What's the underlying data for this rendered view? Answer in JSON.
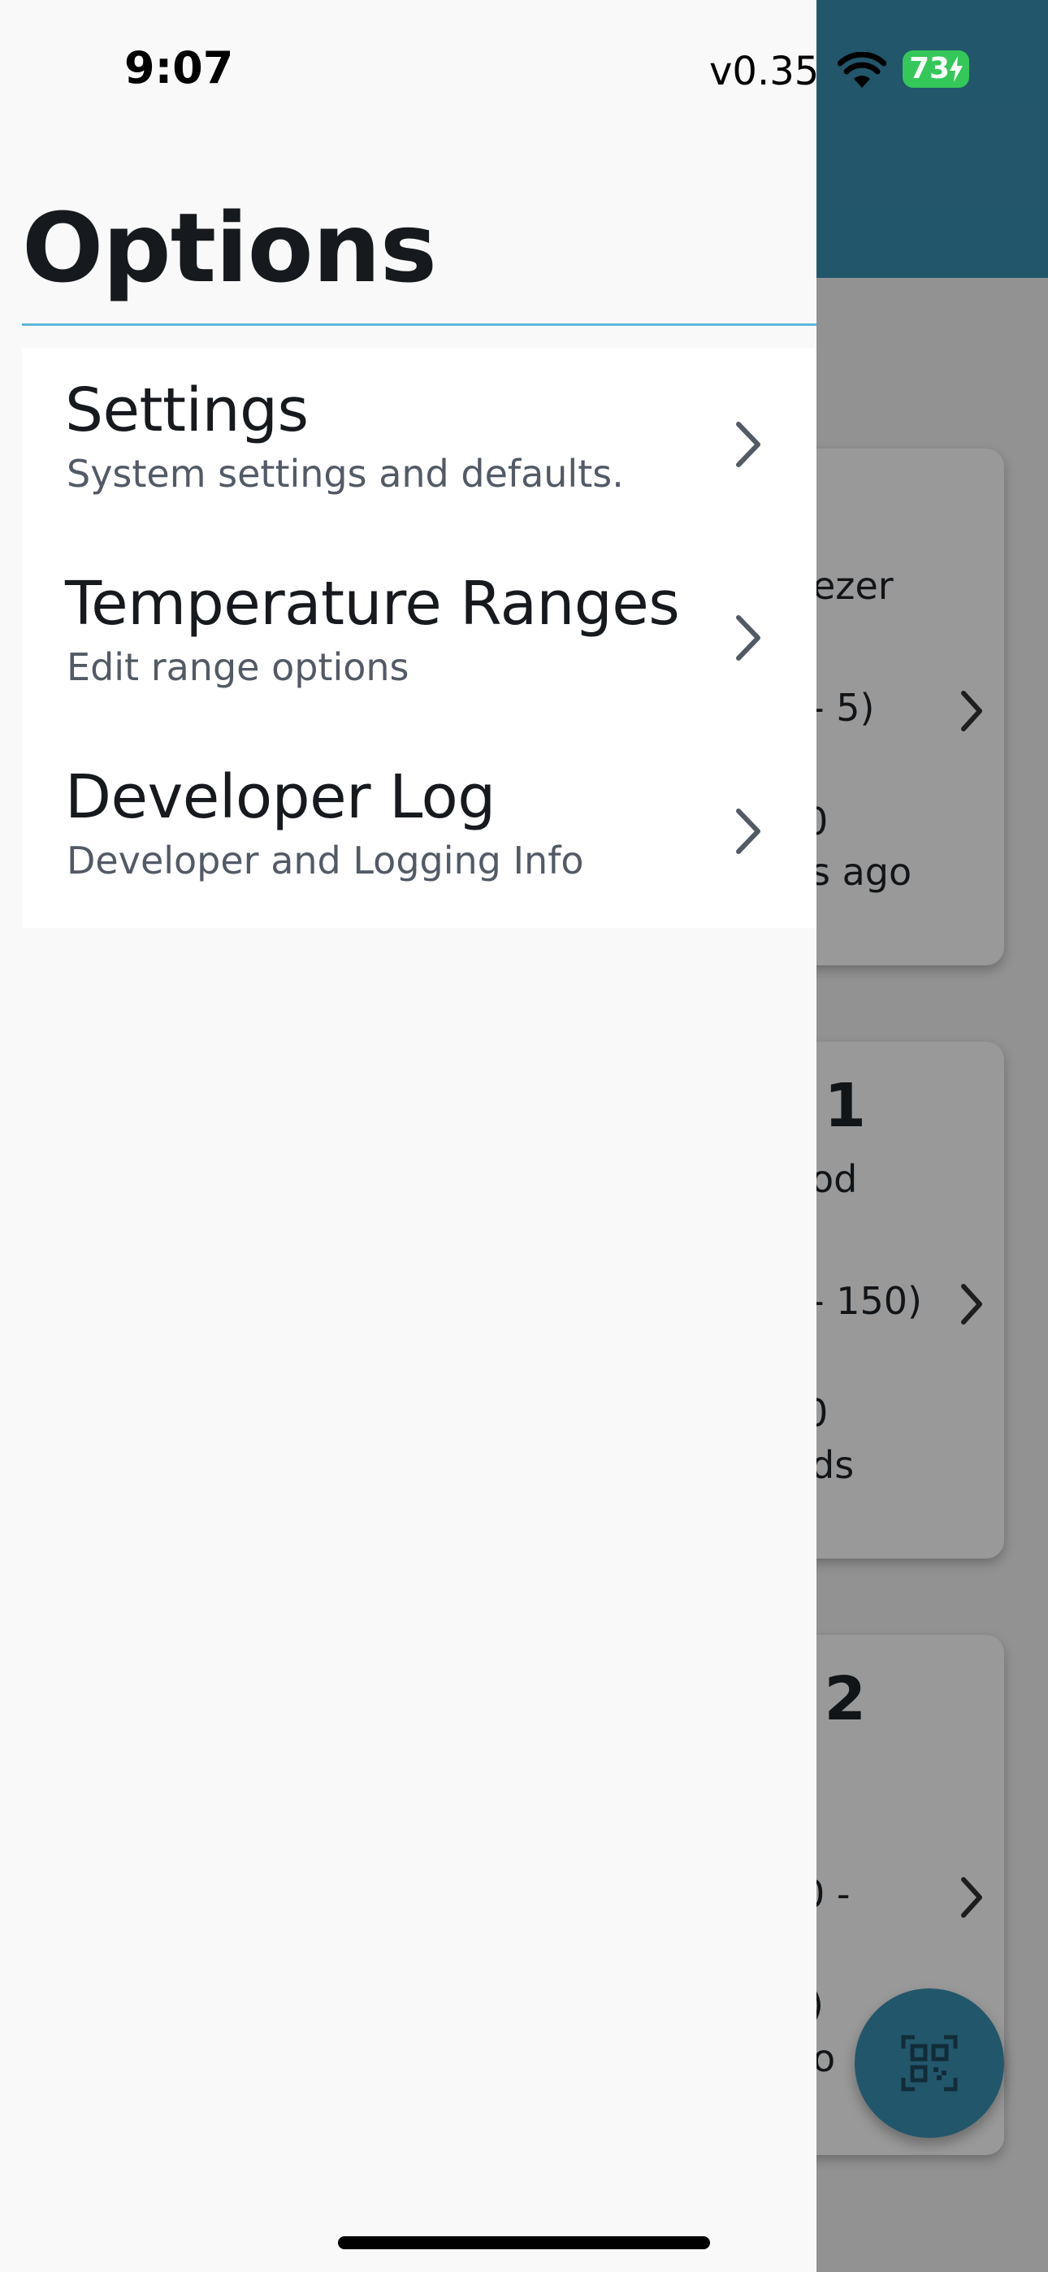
{
  "status_bar": {
    "time": "9:07",
    "version": "v0.35",
    "battery": "73"
  },
  "background_app": {
    "cards": [
      {
        "fragments": [
          "ezer",
          "- 5)",
          "0",
          "s ago"
        ]
      },
      {
        "fragments": [
          "- 1",
          "od",
          "- 150)",
          "0",
          "ds"
        ]
      },
      {
        "fragments": [
          "- 2",
          "0 -",
          ")",
          "o"
        ]
      }
    ],
    "fab_icon": "qr-code-scan-icon"
  },
  "drawer": {
    "title": "Options",
    "items": [
      {
        "label": "Settings",
        "subtitle": "System settings and defaults.",
        "icon": "chevron-right-icon"
      },
      {
        "label": "Temperature Ranges",
        "subtitle": "Edit range options",
        "icon": "chevron-right-icon"
      },
      {
        "label": "Developer Log",
        "subtitle": "Developer and Logging Info",
        "icon": "chevron-right-icon"
      }
    ]
  },
  "colors": {
    "app_bar": "#3a8fb2",
    "divider_accent": "#5fb8de",
    "battery": "#34c759"
  }
}
